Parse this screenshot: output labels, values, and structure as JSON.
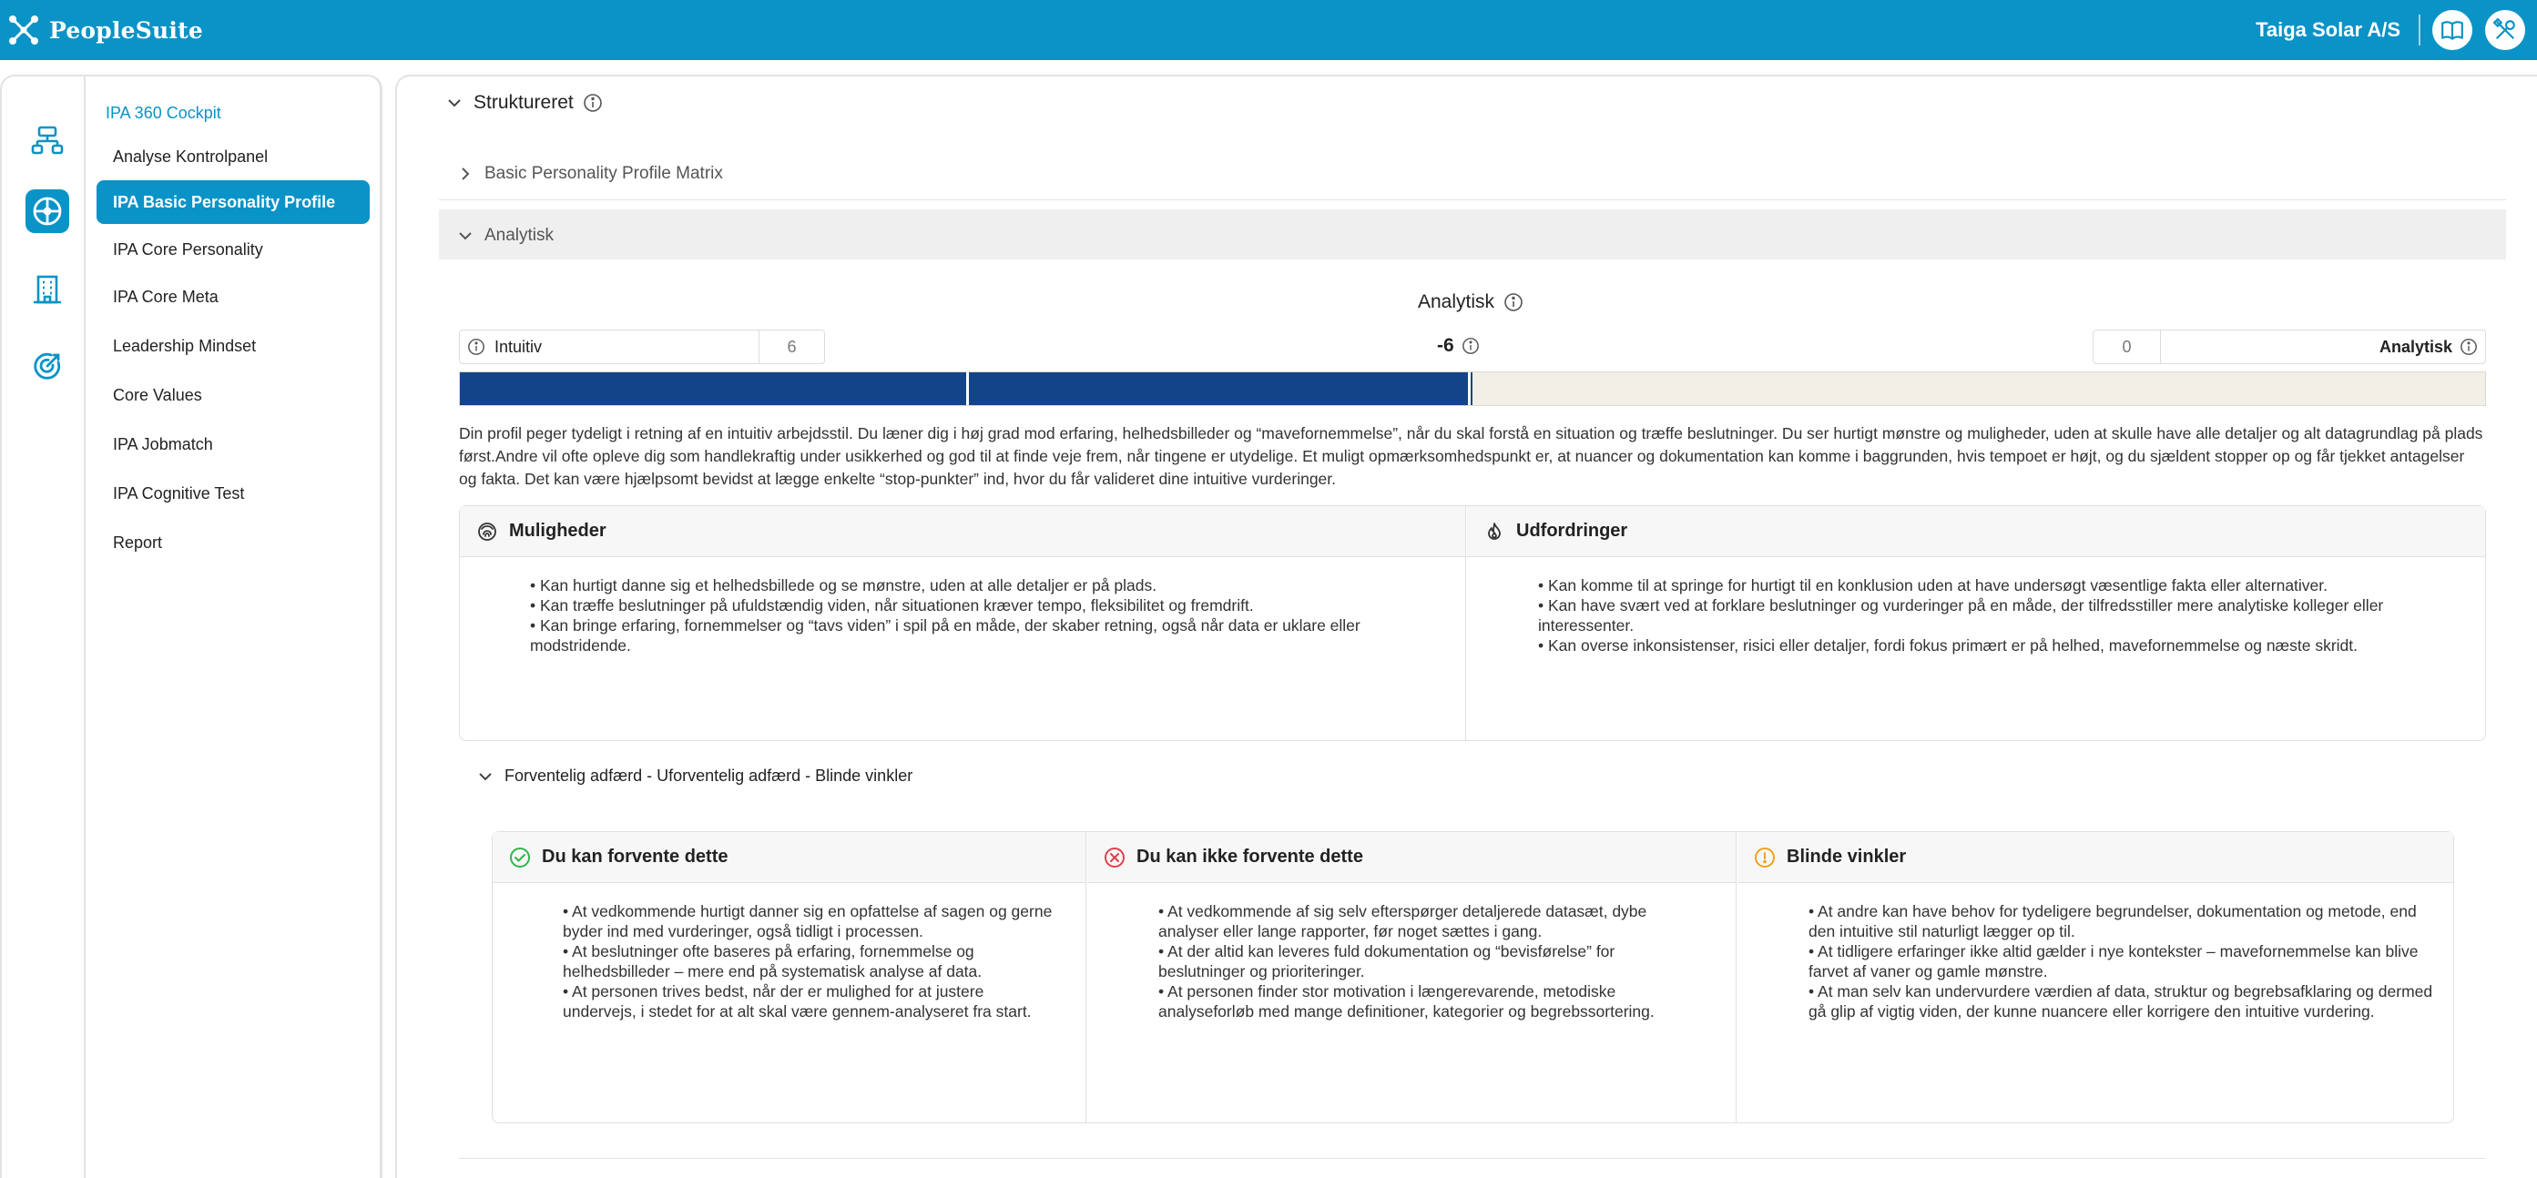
{
  "app": {
    "name": "PeopleSuite",
    "company": "Taiga Solar A/S"
  },
  "nav": {
    "title": "IPA 360 Cockpit",
    "items": [
      {
        "label": "Analyse Kontrolpanel"
      },
      {
        "label": "IPA Basic Personality Profile"
      },
      {
        "label": "IPA Core Personality"
      },
      {
        "label": "IPA Core Meta"
      },
      {
        "label": "Leadership Mindset"
      },
      {
        "label": "Core Values"
      },
      {
        "label": "IPA Jobmatch"
      },
      {
        "label": "IPA Cognitive Test"
      },
      {
        "label": "Report"
      }
    ]
  },
  "main": {
    "section_title": "Struktureret",
    "collapsed_section": "Basic Personality Profile Matrix",
    "expanded_section": "Analytisk",
    "scale": {
      "title": "Analytisk",
      "left_label": "Intuitiv",
      "left_value": "6",
      "score": "-6",
      "right_value": "0",
      "right_label": "Analytisk",
      "fill_fraction": 0.5
    },
    "description": "Din profil peger tydeligt i retning af en intuitiv arbejdsstil. Du læner dig i høj grad mod erfaring, helhedsbilleder og “mavefornemmelse”, når du skal forstå en situation og træffe beslutninger. Du ser hurtigt mønstre og muligheder, uden at skulle have alle detaljer og alt datagrundlag på plads først.Andre vil ofte opleve dig som handlekraftig under usikkerhed og god til at finde veje frem, når tingene er utydelige. Et muligt opmærksomhedspunkt er, at nuancer og dokumentation kan komme i baggrunden, hvis tempoet er højt, og du sjældent stopper op og får tjekket antagelser og fakta. Det kan være hjælpsomt bevidst at lægge enkelte “stop-punkter” ind, hvor du får valideret dine intuitive vurderinger.",
    "opportunities": {
      "title": "Muligheder",
      "items": [
        "• Kan hurtigt danne sig et helhedsbillede og se mønstre, uden at alle detaljer er på plads.",
        "• Kan træffe beslutninger på ufuldstændig viden, når situationen kræver tempo, fleksibilitet og fremdrift.",
        "• Kan bringe erfaring, fornemmelser og “tavs viden” i spil på en måde, der skaber retning, også når data er uklare eller modstridende."
      ]
    },
    "challenges": {
      "title": "Udfordringer",
      "items": [
        "• Kan komme til at springe for hurtigt til en konklusion uden at have undersøgt væsentlige fakta eller alternativer.",
        "• Kan have svært ved at forklare beslutninger og vurderinger på en måde, der tilfredsstiller mere analytiske kolleger eller interessenter.",
        "• Kan overse inkonsistenser, risici eller detaljer, fordi fokus primært er på helhed, mavefornemmelse og næste skridt."
      ]
    },
    "behavior_section": "Forventelig adfærd - Uforventelig adfærd - Blinde vinkler",
    "expect": {
      "title": "Du kan forvente dette",
      "items": [
        "• At vedkommende hurtigt danner sig en opfattelse af sagen og gerne byder ind med vurderinger, også tidligt i processen.",
        "• At beslutninger ofte baseres på erfaring, fornemmelse og helhedsbilleder – mere end på systematisk analyse af data.",
        "• At personen trives bedst, når der er mulighed for at justere undervejs, i stedet for at alt skal være gennem-analyseret fra start."
      ]
    },
    "not_expect": {
      "title": "Du kan ikke forvente dette",
      "items": [
        "• At vedkommende af sig selv efterspørger detaljerede datasæt, dybe analyser eller lange rapporter, før noget sættes i gang.",
        "• At der altid kan leveres fuld dokumentation og “bevisførelse” for beslutninger og prioriteringer.",
        "• At personen finder stor motivation i længerevarende, metodiske analyseforløb med mange definitioner, kategorier og begrebssortering."
      ]
    },
    "blind_spots": {
      "title": "Blinde vinkler",
      "items": [
        "• At andre kan have behov for tydeligere begrundelser, dokumentation og metode, end den intuitive stil naturligt lægger op til.",
        "• At tidligere erfaringer ikke altid gælder i nye kontekster – mavefornemmelse kan blive farvet af vaner og gamle mønstre.",
        "• At man selv kan undervurdere værdien af data, struktur og begrebsafklaring og dermed gå glip af vigtig viden, der kunne nuancere eller korrigere den intuitive vurdering."
      ]
    }
  },
  "colors": {
    "brand": "#0a93c6",
    "bar_fill": "#134488",
    "bar_track": "#f2efe6",
    "expect_icon": "#2fb64a",
    "not_expect_icon": "#e0404a",
    "blind_icon": "#f0a020"
  },
  "icons": {
    "logo": "peoplesuite-logo-icon",
    "top_buttons": [
      "book-icon",
      "tools-icon"
    ],
    "rail": [
      "org-chart-icon",
      "compass-icon",
      "building-icon",
      "target-icon"
    ]
  }
}
